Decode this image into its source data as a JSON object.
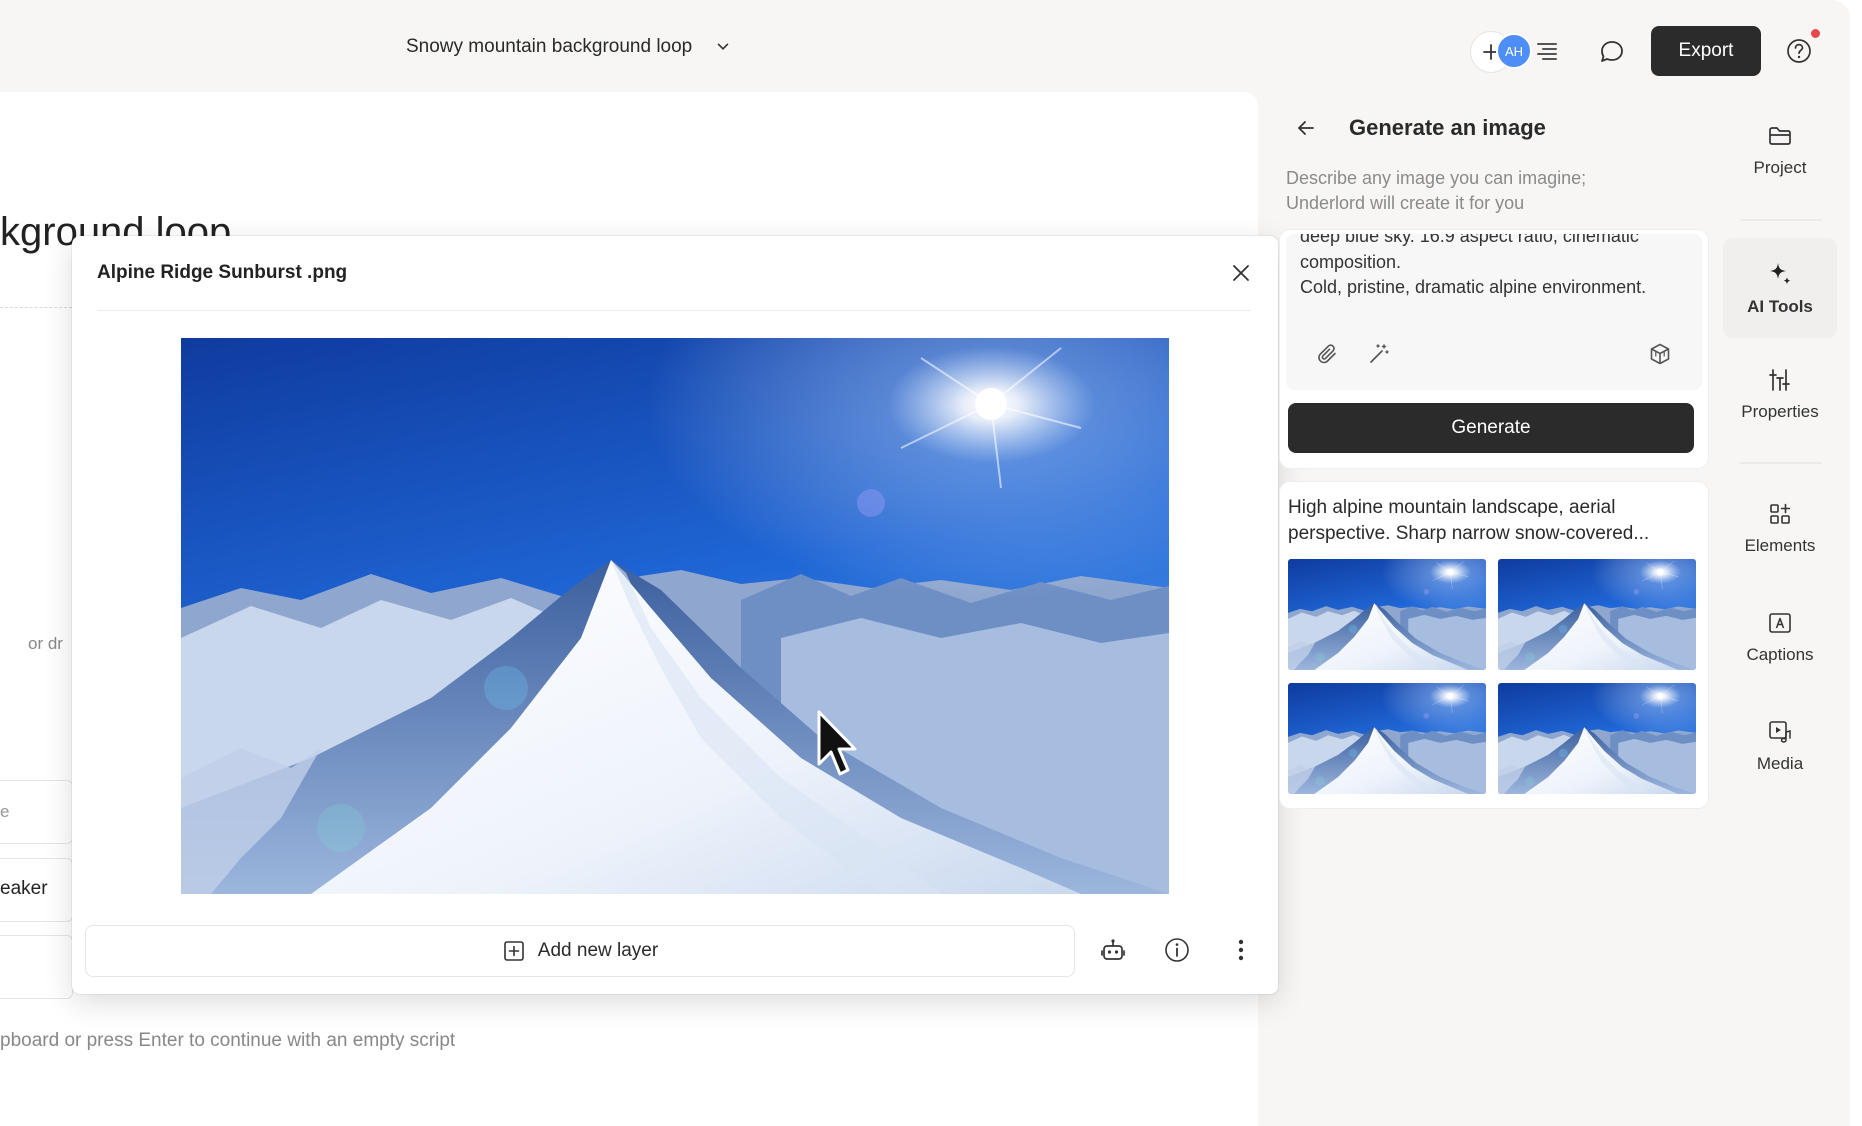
{
  "topbar": {
    "project_title": "Snowy mountain background loop",
    "avatar_initials": "AH",
    "export_label": "Export"
  },
  "background": {
    "heading_fragment": "kground loop",
    "or_fragment": "or dr",
    "field_fragment": "e",
    "speaker_fragment": "eaker",
    "hint_fragment": "pboard or press Enter to continue with an empty script"
  },
  "modal": {
    "title": "Alpine Ridge Sunburst .png",
    "add_layer_label": "Add new layer"
  },
  "ai_panel": {
    "title": "Generate an image",
    "description": "Describe any image you can imagine; Underlord will create it for you",
    "prompt_text": "deep blue sky. 16:9 aspect ratio, cinematic composition.\nCold, pristine, dramatic alpine environment.",
    "generate_label": "Generate",
    "result_prompt": "High alpine mountain landscape, aerial perspective. Sharp narrow snow-covered..."
  },
  "sidebar": {
    "items": [
      {
        "label": "Project",
        "icon": "folder-icon"
      },
      {
        "label": "AI Tools",
        "icon": "sparkle-icon"
      },
      {
        "label": "Properties",
        "icon": "sliders-icon"
      },
      {
        "label": "Elements",
        "icon": "shapes-icon"
      },
      {
        "label": "Captions",
        "icon": "captions-icon"
      },
      {
        "label": "Media",
        "icon": "media-icon"
      }
    ]
  },
  "colors": {
    "accent_dark": "#2b2b2b",
    "avatar_blue": "#4e8ef7",
    "notification_red": "#e5484d"
  }
}
